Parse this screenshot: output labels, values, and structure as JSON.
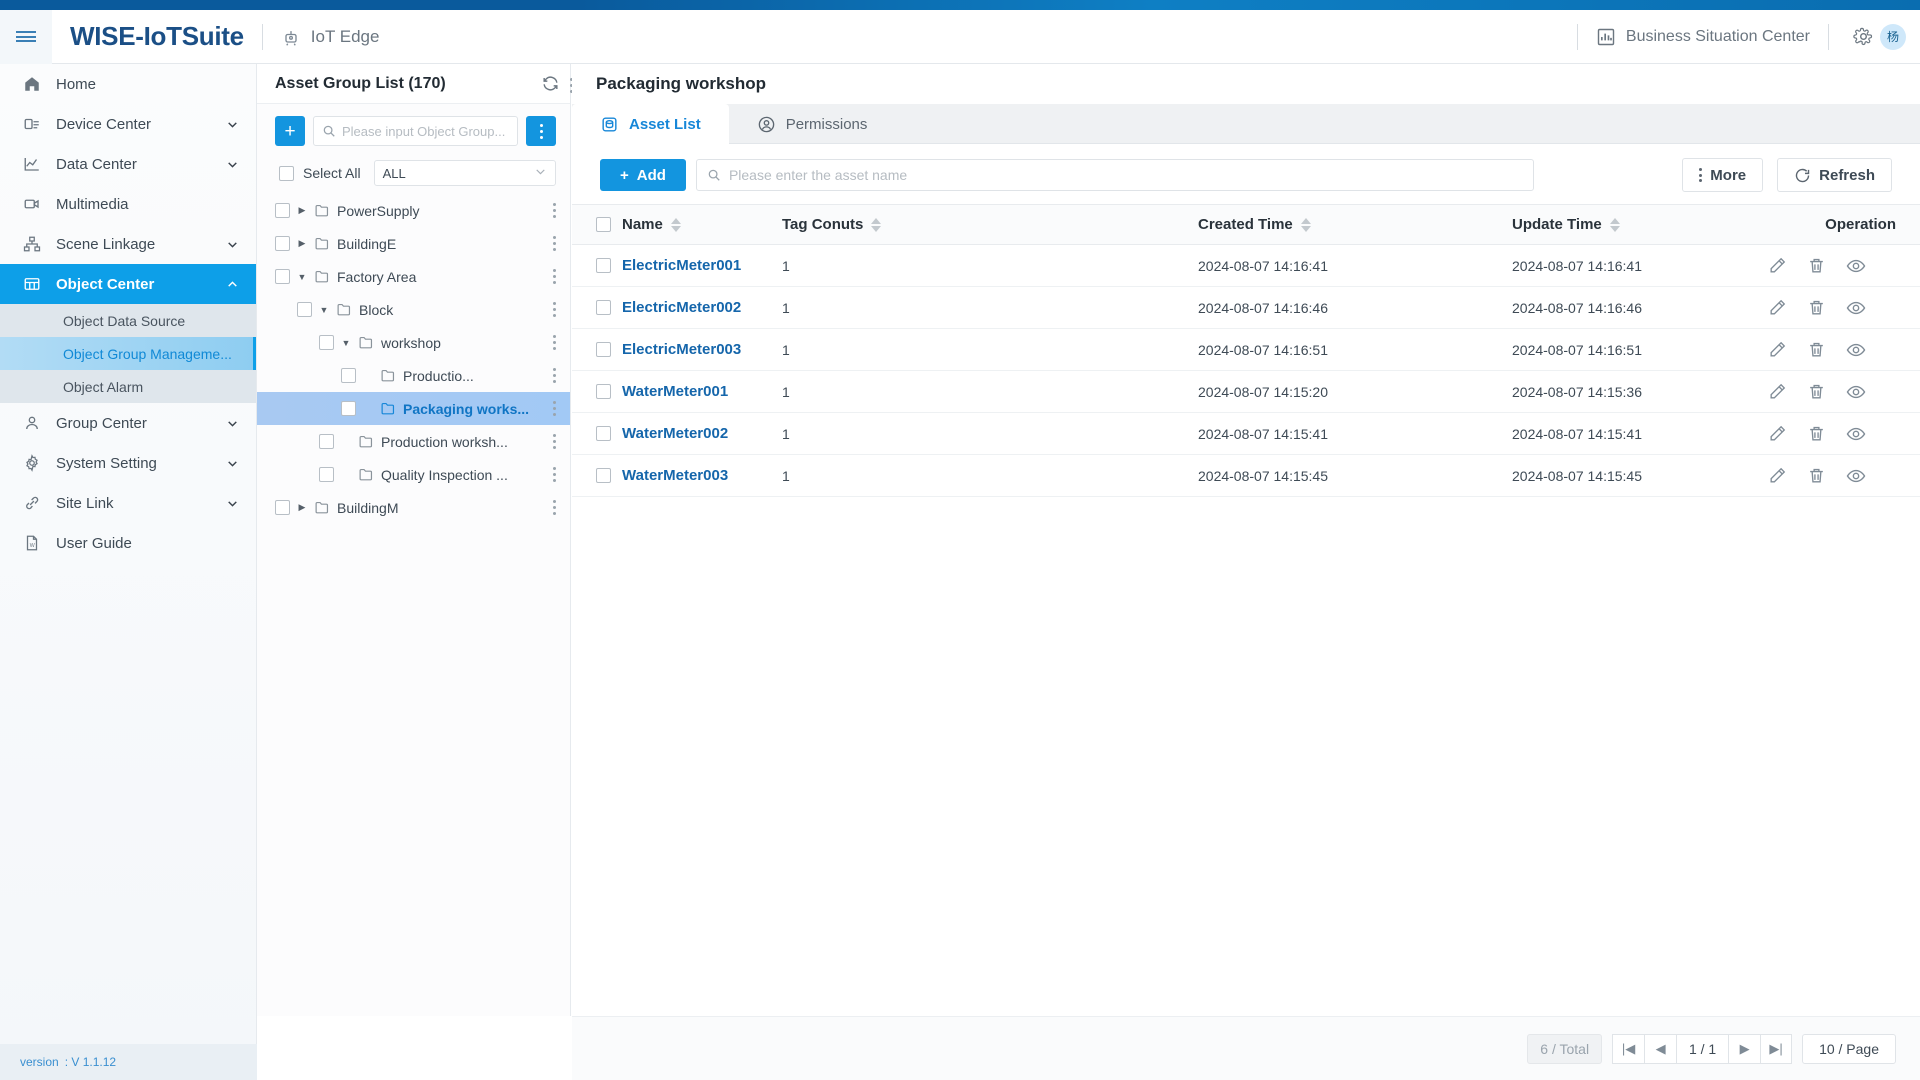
{
  "header": {
    "menu_icon": "hamburger-icon",
    "brand": "WISE-IoTSuite",
    "edge_label": "IoT Edge",
    "edge_icon": "iot-edge-icon",
    "business_center_label": "Business Situation Center",
    "business_center_icon": "bar-chart-icon",
    "settings_icon": "gear-icon",
    "avatar_initial": "杨",
    "accent": "#1395df",
    "brand_color": "#1b4f86"
  },
  "sidebar": {
    "items": [
      {
        "label": "Home",
        "icon": "home-icon",
        "expandable": false
      },
      {
        "label": "Device Center",
        "icon": "device-icon",
        "expandable": true
      },
      {
        "label": "Data Center",
        "icon": "chart-line-icon",
        "expandable": true
      },
      {
        "label": "Multimedia",
        "icon": "video-icon",
        "expandable": false
      },
      {
        "label": "Scene Linkage",
        "icon": "sitemap-icon",
        "expandable": true
      },
      {
        "label": "Object Center",
        "icon": "grid-icon",
        "expandable": true,
        "active": true
      },
      {
        "label": "Group Center",
        "icon": "user-icon",
        "expandable": true
      },
      {
        "label": "System Setting",
        "icon": "gear-icon",
        "expandable": true
      },
      {
        "label": "Site Link",
        "icon": "link-icon",
        "expandable": true
      },
      {
        "label": "User Guide",
        "icon": "document-icon",
        "expandable": false
      }
    ],
    "sub_items": [
      {
        "label": "Object Data Source",
        "selected": false
      },
      {
        "label": "Object Group Manageme...",
        "selected": true
      },
      {
        "label": "Object Alarm",
        "selected": false
      }
    ],
    "version_label": "version",
    "version_value": ": V 1.1.12"
  },
  "tree_panel": {
    "title": "Asset Group List (170)",
    "refresh_icon": "refresh-icon",
    "more_icon": "vertical-dots-icon",
    "add_button": "+",
    "search_placeholder": "Please input Object Group...",
    "search_value": "",
    "search_icon": "search-icon",
    "options_icon": "vertical-dots-icon",
    "select_all_label": "Select All",
    "scope_value": "ALL",
    "nodes": [
      {
        "label": "PowerSupply",
        "depth": 0,
        "caret": "right",
        "selected": false
      },
      {
        "label": "BuildingE",
        "depth": 0,
        "caret": "right",
        "selected": false
      },
      {
        "label": "Factory Area",
        "depth": 0,
        "caret": "down",
        "selected": false
      },
      {
        "label": "Block",
        "depth": 1,
        "caret": "down",
        "selected": false
      },
      {
        "label": "workshop",
        "depth": 2,
        "caret": "down",
        "selected": false
      },
      {
        "label": "Productio...",
        "depth": 3,
        "caret": "none",
        "selected": false
      },
      {
        "label": "Packaging works...",
        "depth": 3,
        "caret": "none",
        "selected": true
      },
      {
        "label": "Production worksh...",
        "depth": 2,
        "caret": "none",
        "selected": false
      },
      {
        "label": "Quality Inspection ...",
        "depth": 2,
        "caret": "none",
        "selected": false
      },
      {
        "label": "BuildingM",
        "depth": 0,
        "caret": "right",
        "selected": false
      }
    ]
  },
  "main": {
    "title": "Packaging workshop",
    "tabs": [
      {
        "label": "Asset List",
        "icon": "database-icon",
        "active": true
      },
      {
        "label": "Permissions",
        "icon": "user-circle-icon",
        "active": false
      }
    ],
    "add_label": "Add",
    "search_placeholder": "Please enter the asset name",
    "search_value": "",
    "search_icon": "search-icon",
    "more_label": "More",
    "more_icon": "vertical-dots-icon",
    "refresh_label": "Refresh",
    "refresh_icon": "refresh-icon",
    "table": {
      "columns": [
        {
          "key": "name",
          "label": "Name",
          "sortable": true
        },
        {
          "key": "tag_counts",
          "label": "Tag Conuts",
          "sortable": true
        },
        {
          "key": "created",
          "label": "Created Time",
          "sortable": true
        },
        {
          "key": "updated",
          "label": "Update Time",
          "sortable": true
        },
        {
          "key": "operation",
          "label": "Operation",
          "sortable": false
        }
      ],
      "rows": [
        {
          "name": "ElectricMeter001",
          "tag_counts": "1",
          "created": "2024-08-07 14:16:41",
          "updated": "2024-08-07 14:16:41"
        },
        {
          "name": "ElectricMeter002",
          "tag_counts": "1",
          "created": "2024-08-07 14:16:46",
          "updated": "2024-08-07 14:16:46"
        },
        {
          "name": "ElectricMeter003",
          "tag_counts": "1",
          "created": "2024-08-07 14:16:51",
          "updated": "2024-08-07 14:16:51"
        },
        {
          "name": "WaterMeter001",
          "tag_counts": "1",
          "created": "2024-08-07 14:15:20",
          "updated": "2024-08-07 14:15:36"
        },
        {
          "name": "WaterMeter002",
          "tag_counts": "1",
          "created": "2024-08-07 14:15:41",
          "updated": "2024-08-07 14:15:41"
        },
        {
          "name": "WaterMeter003",
          "tag_counts": "1",
          "created": "2024-08-07 14:15:45",
          "updated": "2024-08-07 14:15:45"
        }
      ],
      "row_ops": [
        "edit-icon",
        "delete-icon",
        "view-icon"
      ]
    },
    "pagination": {
      "total_label": "6 / Total",
      "first_label": "|◀",
      "prev_label": "◀",
      "current_label": "1 / 1",
      "next_label": "▶",
      "last_label": "▶|",
      "page_size_label": "10 / Page"
    }
  }
}
